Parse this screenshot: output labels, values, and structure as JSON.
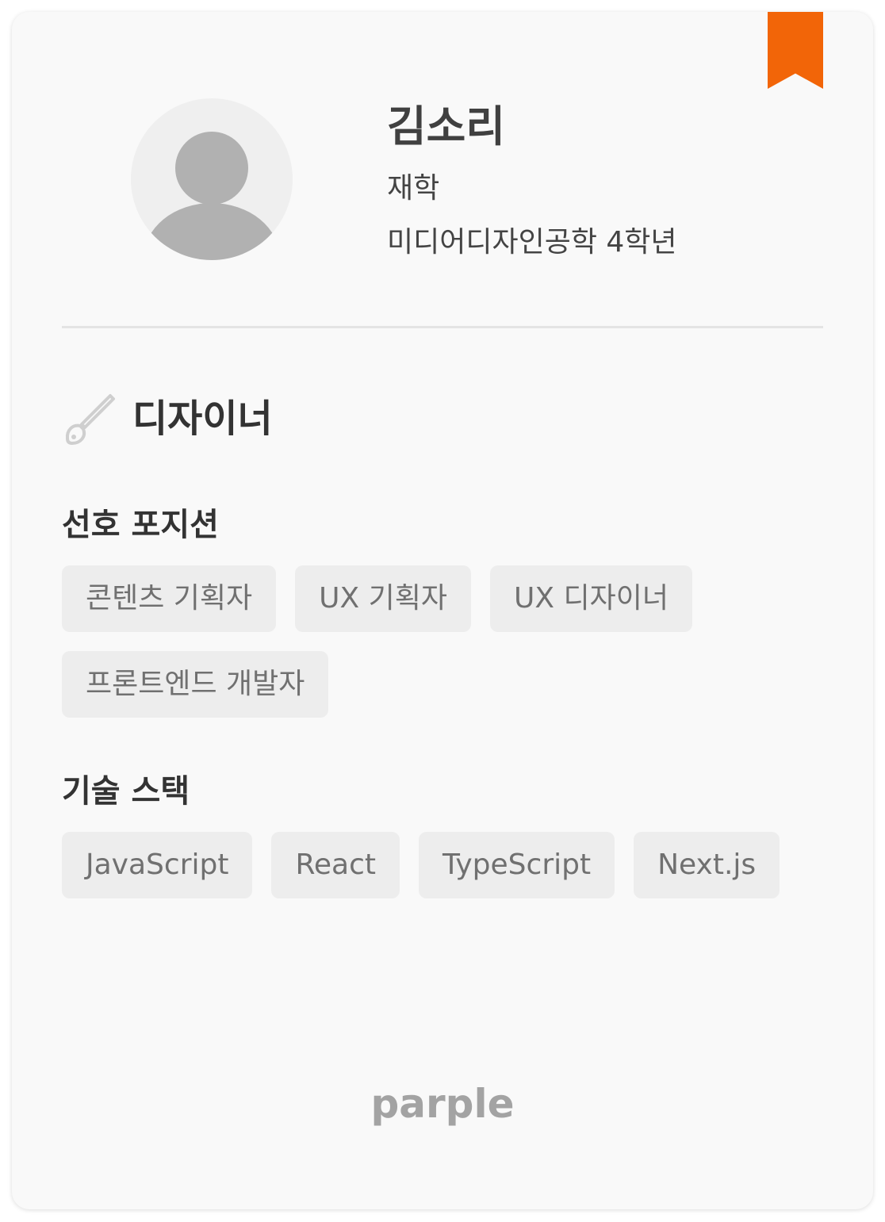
{
  "profile": {
    "name": "김소리",
    "status": "재학",
    "major": "미디어디자인공학 4학년",
    "role": "디자이너"
  },
  "positions": {
    "title": "선호 포지션",
    "items": [
      "콘텐츠 기획자",
      "UX 기획자",
      "UX 디자이너",
      "프론트엔드 개발자"
    ]
  },
  "stack": {
    "title": "기술 스택",
    "items": [
      "JavaScript",
      "React",
      "TypeScript",
      "Next.js"
    ]
  },
  "brand": "parple",
  "icons": {
    "bookmark": "bookmark-icon",
    "avatar": "user-avatar-icon",
    "role": "paintbrush-icon"
  },
  "colors": {
    "accent": "#f26508",
    "card_bg": "#f9f9f9",
    "tag_bg": "#ededed"
  }
}
